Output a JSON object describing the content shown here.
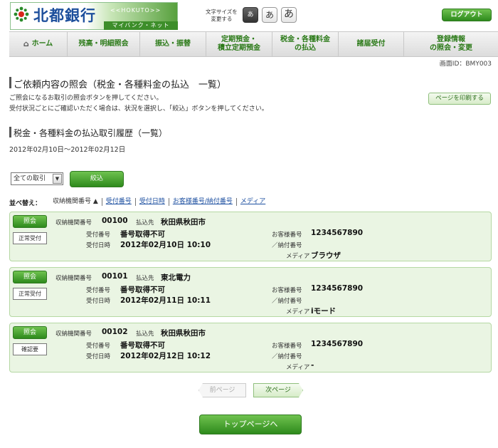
{
  "header": {
    "bank_name": "北都銀行",
    "brand_en": "<<HOKUTO>>",
    "brand_sub": "マイバンク・ネット",
    "font_size_label_1": "文字サイズを",
    "font_size_label_2": "変更する",
    "font_sizes": [
      "あ",
      "あ",
      "あ"
    ],
    "logout": "ログアウト"
  },
  "nav": {
    "items": [
      {
        "label": "ホーム"
      },
      {
        "label": "残高・明細照会"
      },
      {
        "label": "振込・振替"
      },
      {
        "label1": "定期預金・",
        "label2": "積立定期預金"
      },
      {
        "label1": "税金・各種料金",
        "label2": "の払込"
      },
      {
        "label": "諸届受付"
      },
      {
        "label1": "登録情報",
        "label2": "の照会・変更"
      }
    ]
  },
  "screen_id": "画面ID：BMY003",
  "page": {
    "title": "ご依頼内容の照会（税金・各種料金の払込　一覧）",
    "desc1": "ご照会になるお取引の照会ボタンを押してください。",
    "desc2": "受付状況ごとにご確認いただく場合は、状況を選択し、「絞込」ボタンを押してください。",
    "print_button": "ページを印刷する",
    "section_title": "税金・各種料金の払込取引履歴（一覧）",
    "period": "2012年02月10日～2012年02月12日"
  },
  "filter": {
    "selected": "全ての取引",
    "button": "絞込"
  },
  "sort": {
    "label": "並べ替え：",
    "current": "収納機関番号 ▲",
    "links": [
      "受付番号",
      "受付日時",
      "お客様番号/納付番号",
      "メディア"
    ]
  },
  "labels": {
    "shuno": "収納機関番号",
    "payee": "払込先",
    "receipt_no": "受付番号",
    "receipt_dt": "受付日時",
    "customer_no": "お客様番号",
    "payment_no": "／納付番号",
    "media": "メディア"
  },
  "records": [
    {
      "button": "照会",
      "status": "正常受付",
      "shuno": "00100",
      "payee": "秋田県秋田市",
      "receipt_no": "番号取得不可",
      "receipt_dt": "2012年02月10日 10:10",
      "customer_no": "1234567890",
      "media": "ブラウザ"
    },
    {
      "button": "照会",
      "status": "正常受付",
      "shuno": "00101",
      "payee": "東北電力",
      "receipt_no": "番号取得不可",
      "receipt_dt": "2012年02月11日 10:11",
      "customer_no": "1234567890",
      "media": "iモード"
    },
    {
      "button": "照会",
      "status": "確認要",
      "shuno": "00102",
      "payee": "秋田県秋田市",
      "receipt_no": "番号取得不可",
      "receipt_dt": "2012年02月12日 10:12",
      "customer_no": "1234567890",
      "media": "-"
    }
  ],
  "paging": {
    "prev": "前ページ",
    "next": "次ページ",
    "top": "トップページへ"
  }
}
